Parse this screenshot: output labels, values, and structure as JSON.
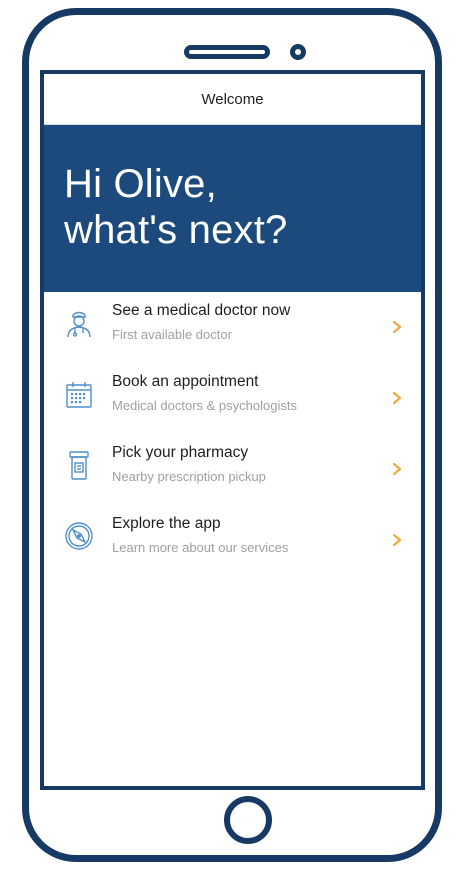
{
  "screen": {
    "title": "Welcome"
  },
  "hero": {
    "line1": "Hi Olive,",
    "line2": "what's next?"
  },
  "menu": {
    "items": [
      {
        "title": "See a medical doctor now",
        "subtitle": "First available doctor",
        "icon": "doctor-icon"
      },
      {
        "title": "Book an appointment",
        "subtitle": "Medical doctors & psychologists",
        "icon": "calendar-icon"
      },
      {
        "title": "Pick your pharmacy",
        "subtitle": "Nearby prescription pickup",
        "icon": "prescription-bottle-icon"
      },
      {
        "title": "Explore the app",
        "subtitle": "Learn more about our services",
        "icon": "compass-icon"
      }
    ]
  },
  "colors": {
    "phone_frame": "#173a64",
    "hero_background": "#1c4a7c",
    "icon_blue": "#4f8fc9",
    "chevron_orange": "#f0a93b"
  }
}
